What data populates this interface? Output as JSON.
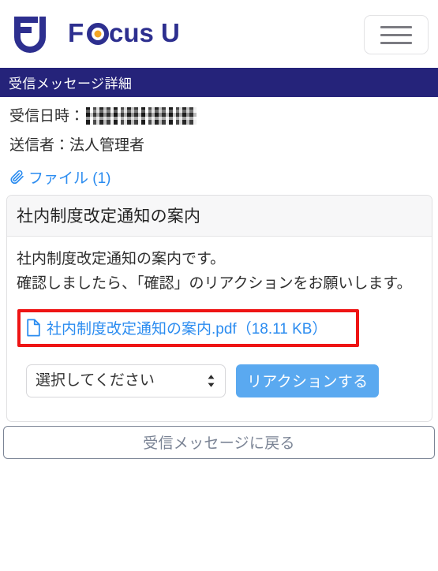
{
  "brand": {
    "name": "Focus U",
    "mark_alt": "FU",
    "logo_navy": "#2d2f8f",
    "logo_orange": "#f5a623",
    "menu_label": "menu"
  },
  "header": {
    "title": "受信メッセージ詳細",
    "bar_color": "#25237a"
  },
  "meta": {
    "received_label": "受信日時：",
    "received_value": "",
    "received_value_redacted": true,
    "sender_label": "送信者：",
    "sender_value": "法人管理者",
    "file_count_label": "ファイル (1)",
    "link_color": "#2b8cf0"
  },
  "message": {
    "subject": "社内制度改定通知の案内",
    "body": "社内制度改定通知の案内です。\n確認しましたら、「確認」のリアクションをお願いします。"
  },
  "attachment": {
    "filename": "社内制度改定通知の案内.pdf（18.11 KB）",
    "highlight_color": "#ee1414"
  },
  "actions": {
    "select_value": "選択してください",
    "select_options": [
      "選択してください"
    ],
    "reaction_button": "リアクションする",
    "reaction_button_color": "#5aa9f0",
    "back_button": "受信メッセージに戻る"
  }
}
